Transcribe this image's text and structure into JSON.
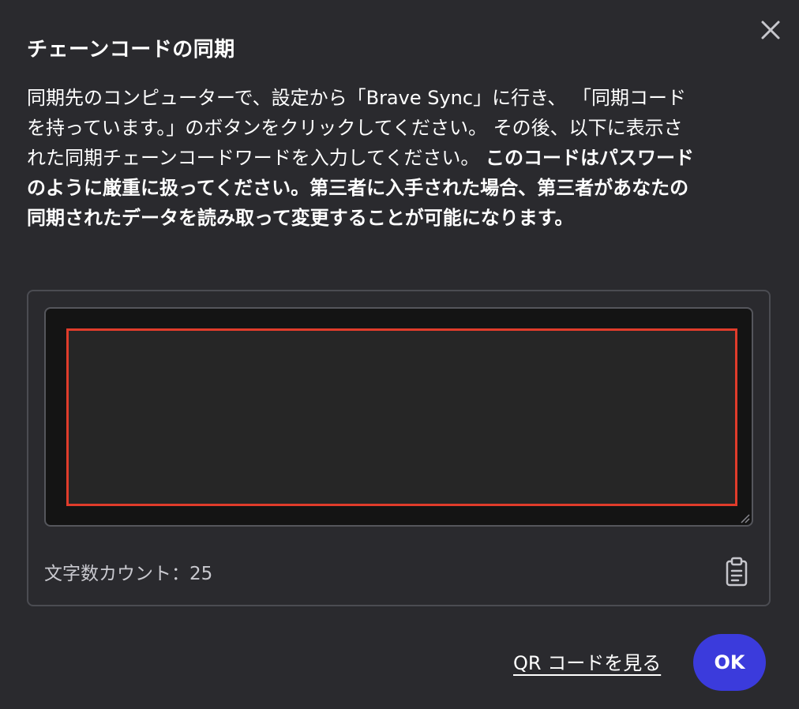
{
  "dialog": {
    "title": "チェーンコードの同期",
    "description_normal": "同期先のコンピューターで、設定から「Brave Sync」に行き、 「同期コードを持っています。」のボタンをクリックしてください。 その後、以下に表示された同期チェーンコードワードを入力してください。 ",
    "description_warning": "このコードはパスワードのように厳重に扱ってください。第三者に入手された場合、第三者があなたの同期されたデータを読み取って変更することが可能になります。",
    "char_count": "文字数カウント：25",
    "qr_link": "QR コードを見る",
    "ok_label": "OK"
  },
  "icons": {
    "close": "close-icon",
    "clipboard": "clipboard-icon",
    "resize": "resize-handle-icon"
  },
  "colors": {
    "background": "#2a2a2e",
    "accent": "#3b3bdc",
    "highlight_border": "#e03c2b"
  }
}
